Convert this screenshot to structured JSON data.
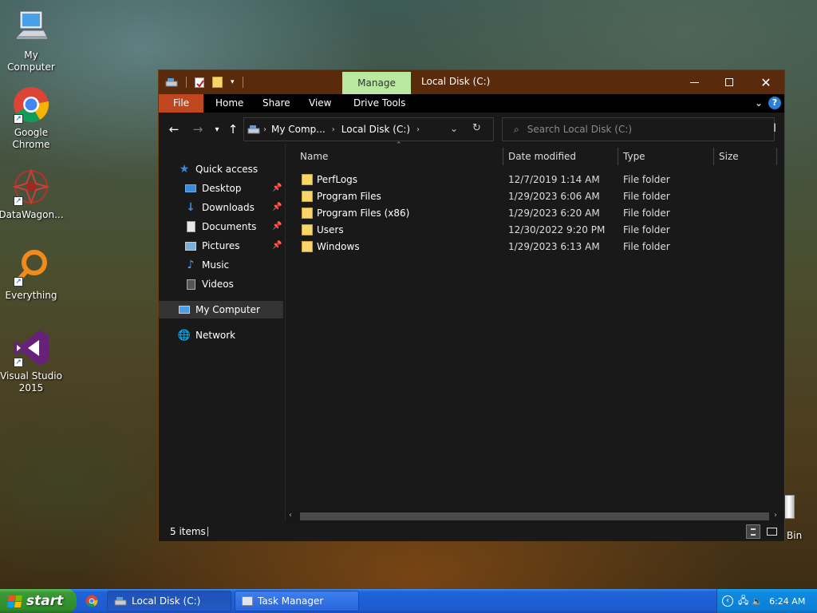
{
  "desktop": {
    "icons": [
      {
        "label": "My Computer"
      },
      {
        "label": "Google Chrome"
      },
      {
        "label": "DataWagon..."
      },
      {
        "label": "Everything"
      },
      {
        "label": "Visual Studio 2015"
      }
    ],
    "recycle_label": "Bin"
  },
  "window": {
    "manage_tab": "Manage",
    "title": "Local Disk (C:)",
    "ribbon": {
      "file": "File",
      "home": "Home",
      "share": "Share",
      "view": "View",
      "drive_tools": "Drive Tools"
    },
    "address": {
      "crumb1": "My Comp...",
      "crumb2": "Local Disk (C:)"
    },
    "search_placeholder": "Search Local Disk (C:)",
    "nav": {
      "quick_access": "Quick access",
      "desktop": "Desktop",
      "downloads": "Downloads",
      "documents": "Documents",
      "pictures": "Pictures",
      "music": "Music",
      "videos": "Videos",
      "my_computer": "My Computer",
      "network": "Network"
    },
    "columns": {
      "name": "Name",
      "date": "Date modified",
      "type": "Type",
      "size": "Size"
    },
    "files": [
      {
        "name": "PerfLogs",
        "date": "12/7/2019 1:14 AM",
        "type": "File folder"
      },
      {
        "name": "Program Files",
        "date": "1/29/2023 6:06 AM",
        "type": "File folder"
      },
      {
        "name": "Program Files (x86)",
        "date": "1/29/2023 6:20 AM",
        "type": "File folder"
      },
      {
        "name": "Users",
        "date": "12/30/2022 9:20 PM",
        "type": "File folder"
      },
      {
        "name": "Windows",
        "date": "1/29/2023 6:13 AM",
        "type": "File folder"
      }
    ],
    "status": "5 items"
  },
  "taskbar": {
    "start": "start",
    "tasks": [
      {
        "label": "Local Disk (C:)"
      },
      {
        "label": "Task Manager"
      }
    ],
    "clock": "6:24 AM"
  }
}
